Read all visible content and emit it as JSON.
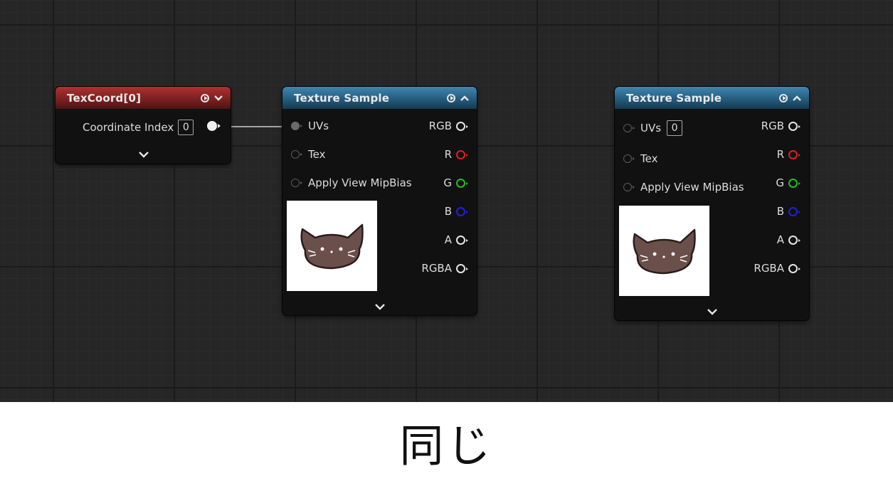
{
  "texcoord_node": {
    "title": "TexCoord[0]",
    "coordinate_index_label": "Coordinate Index",
    "coordinate_index_value": "0"
  },
  "texture_sample_left": {
    "title": "Texture Sample",
    "inputs": [
      "UVs",
      "Tex",
      "Apply View MipBias"
    ],
    "outputs": [
      "RGB",
      "R",
      "G",
      "B",
      "A",
      "RGBA"
    ]
  },
  "texture_sample_right": {
    "title": "Texture Sample",
    "inputs": [
      "UVs",
      "Tex",
      "Apply View MipBias"
    ],
    "uvs_default_value": "0",
    "outputs": [
      "RGB",
      "R",
      "G",
      "B",
      "A",
      "RGBA"
    ]
  },
  "pin_colors": {
    "R": "#e02020",
    "G": "#20c020",
    "B": "#2020e0",
    "default": "#e6e6e6"
  },
  "caption": "同じ"
}
